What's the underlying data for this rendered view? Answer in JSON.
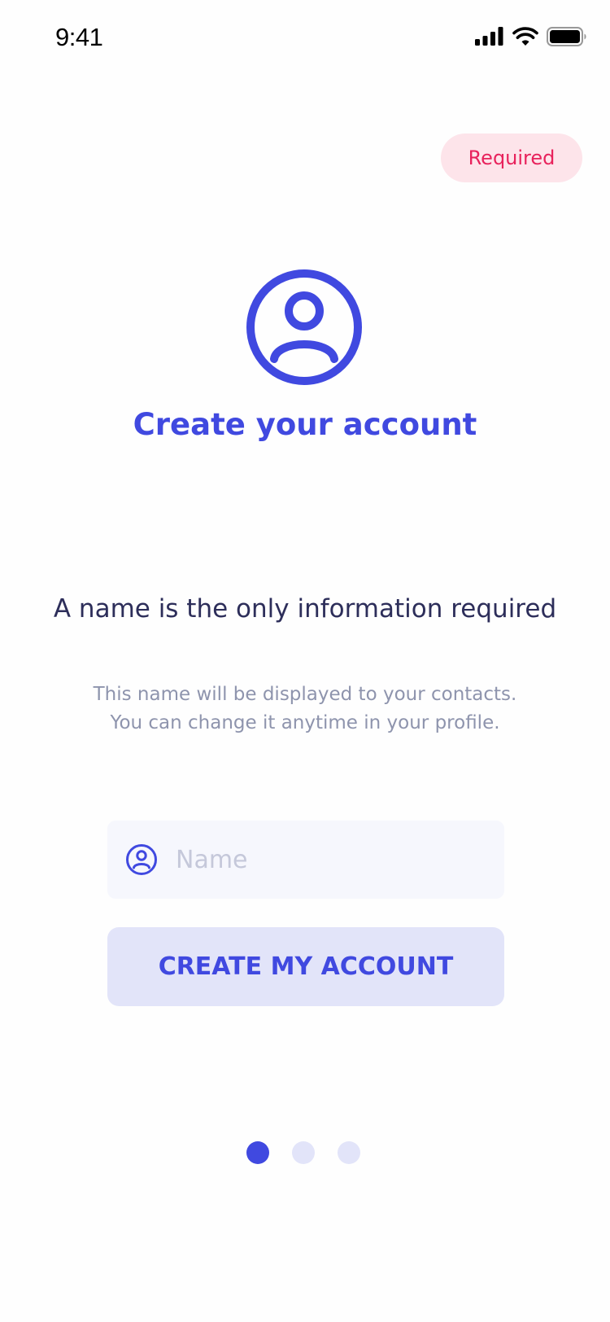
{
  "status_bar": {
    "time": "9:41",
    "icons": [
      "signal-icon",
      "wifi-icon",
      "battery-icon"
    ]
  },
  "badge": {
    "label": "Required",
    "color": "#e8225c",
    "background": "#fde4ea"
  },
  "hero": {
    "icon": "user-circle-icon",
    "title": "Create your account"
  },
  "info": {
    "heading": "A name is the only information required",
    "body_lines": [
      "This name will be displayed to your contacts.",
      "You can change it anytime in your profile."
    ]
  },
  "form": {
    "name_field": {
      "icon": "user-circle-icon",
      "placeholder": "Name",
      "value": ""
    },
    "submit_label": "CREATE MY ACCOUNT"
  },
  "pager": {
    "total": 3,
    "active_index": 0
  },
  "colors": {
    "accent": "#4049e0",
    "accent_light": "#e2e4f9",
    "heading": "#2d2e5a",
    "muted": "#8e94ad"
  }
}
